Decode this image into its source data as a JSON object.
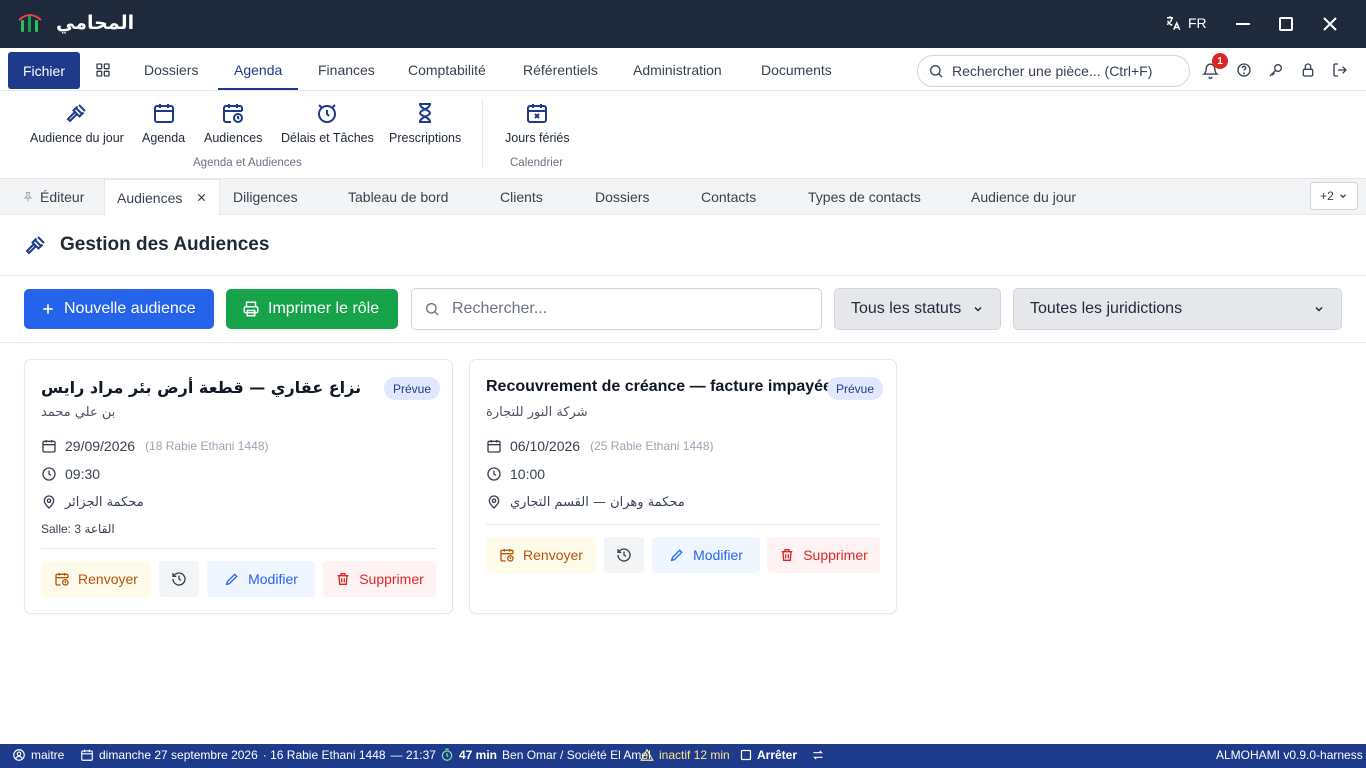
{
  "titlebar": {
    "app_name": "المحامي",
    "lang": "FR"
  },
  "menu": {
    "fichier": "Fichier",
    "items": [
      "Dossiers",
      "Agenda",
      "Finances",
      "Comptabilité",
      "Référentiels",
      "Administration",
      "Documents"
    ],
    "active": "Agenda",
    "search_placeholder": "Rechercher une pièce... (Ctrl+F)",
    "notif_count": "1"
  },
  "ribbon": {
    "items": [
      "Audience du jour",
      "Agenda",
      "Audiences",
      "Délais et Tâches",
      "Prescriptions",
      "Jours fériés"
    ],
    "groups": [
      "Agenda et Audiences",
      "Calendrier"
    ]
  },
  "tabs": {
    "items": [
      "Éditeur",
      "Audiences",
      "Diligences",
      "Tableau de bord",
      "Clients",
      "Dossiers",
      "Contacts",
      "Types de contacts",
      "Audience du jour"
    ],
    "active": "Audiences",
    "more": "+2"
  },
  "page": {
    "title": "Gestion des Audiences",
    "new_btn": "Nouvelle audience",
    "print_btn": "Imprimer le rôle",
    "search_placeholder": "Rechercher...",
    "status_filter": "Tous les statuts",
    "jurisdiction_filter": "Toutes les juridictions"
  },
  "cards": [
    {
      "title": "نزاع عقاري — قطعة أرض بئر مراد رايس",
      "status": "Prévue",
      "client": "بن علي محمد",
      "date": "29/09/2026",
      "hijri": "(18 Rabie Ethani 1448)",
      "time": "09:30",
      "court": "محكمة الجزائر",
      "room": "Salle: القاعة 3"
    },
    {
      "title": "Recouvrement de créance — facture impayée",
      "status": "Prévue",
      "client": "شركة النور للتجارة",
      "date": "06/10/2026",
      "hijri": "(25 Rabie Ethani 1448)",
      "time": "10:00",
      "court": "محكمة وهران — القسم التجاري",
      "room": ""
    }
  ],
  "card_actions": {
    "renvoyer": "Renvoyer",
    "modifier": "Modifier",
    "supprimer": "Supprimer"
  },
  "statusbar": {
    "user": "maitre",
    "date": "dimanche 27 septembre 2026",
    "hijri": "· 16 Rabie Ethani 1448",
    "time": "— 21:37",
    "timer": "47 min",
    "context": "Ben Omar / Société El Amel",
    "inactive": "inactif 12 min",
    "stop": "Arrêter",
    "version": "ALMOHAMI v0.9.0-harness"
  },
  "colors": {
    "titlebar": "#1e293b",
    "primary": "#1e3a8a",
    "new_btn": "#2563eb",
    "print_btn": "#16a34a",
    "badge_bg": "#e0e7ff"
  }
}
